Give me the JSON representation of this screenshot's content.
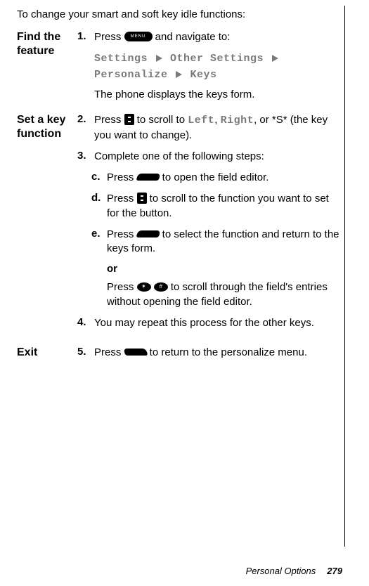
{
  "intro": "To change your smart and soft key idle functions:",
  "blocks": {
    "find": {
      "label": "Find the feature",
      "step1_num": "1.",
      "step1_a": "Press ",
      "step1_b": " and navigate to:",
      "path_settings": "Settings ",
      "path_other": " Other Settings ",
      "path_personalize": "Personalize ",
      "path_keys": " Keys",
      "after": "The phone displays the keys form."
    },
    "setkey": {
      "label": "Set a key function",
      "s2_num": "2.",
      "s2_a": "Press ",
      "s2_b": " to scroll to ",
      "s2_left": "Left",
      "s2_comma": ", ",
      "s2_right": "Right",
      "s2_c": ", or *S* (the key you want to change).",
      "s3_num": "3.",
      "s3_txt": "Complete one of the following steps:",
      "c_num": "c.",
      "c_a": "Press ",
      "c_b": " to open the field editor.",
      "d_num": "d.",
      "d_a": "Press ",
      "d_b": " to scroll to the function you want to set for the button.",
      "e_num": "e.",
      "e_a": "Press ",
      "e_b": " to select the function and return to the keys form.",
      "or": "or",
      "or_a": "Press ",
      "or_b": " to scroll through the field's entries without opening the field editor.",
      "s4_num": "4.",
      "s4_txt": "You may repeat this process for the other keys."
    },
    "exit": {
      "label": "Exit",
      "s5_num": "5.",
      "s5_a": "Press ",
      "s5_b": " to return to the personalize menu."
    }
  },
  "menu_label": "MENU",
  "star_sign": "✶",
  "hash_sign": "#",
  "footer_section": "Personal Options",
  "footer_page": "279"
}
